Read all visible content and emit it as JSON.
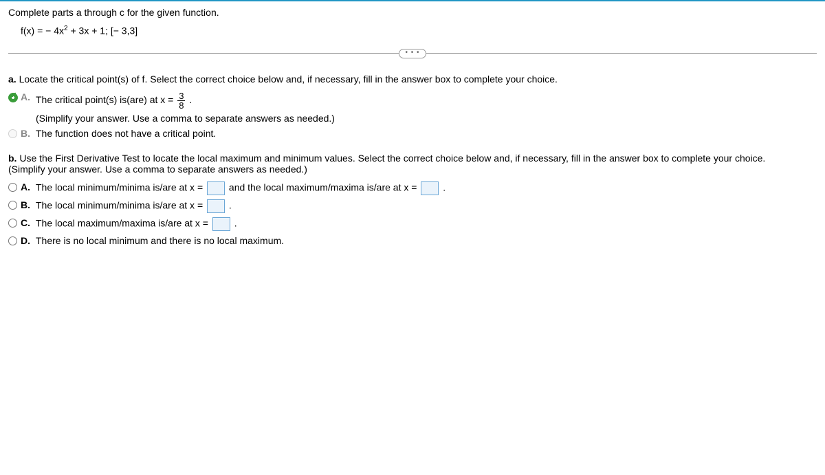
{
  "intro": "Complete parts a through c for the given function.",
  "function_prefix": "f(x) = − 4x",
  "function_exp": "2",
  "function_suffix": " + 3x + 1; [− 3,3]",
  "ellipsis": "• • •",
  "partA": {
    "prompt_prefix": "a.",
    "prompt": " Locate the critical point(s) of f. Select the correct choice below and, if necessary, fill in the answer box to complete your choice.",
    "A_letter": "A.",
    "A_text_before": "The critical point(s) is(are) at x = ",
    "A_frac_num": "3",
    "A_frac_den": "8",
    "A_text_after": " .",
    "A_hint": "(Simplify your answer. Use a comma to separate answers as needed.)",
    "B_letter": "B.",
    "B_text": "The function does not have a critical point."
  },
  "partB": {
    "prompt_prefix": "b.",
    "prompt": " Use the First Derivative Test to locate the local maximum and minimum values. Select the correct choice below and, if necessary, fill in the answer box to complete your choice.",
    "hint": "(Simplify your answer. Use a comma to separate answers as needed.)",
    "A_letter": "A.",
    "A_text1": "The local minimum/minima is/are at x = ",
    "A_text2": " and the local maximum/maxima is/are at x = ",
    "A_text3": " .",
    "B_letter": "B.",
    "B_text1": "The local minimum/minima is/are at x = ",
    "B_text2": " .",
    "C_letter": "C.",
    "C_text1": "The local maximum/maxima is/are at x = ",
    "C_text2": " .",
    "D_letter": "D.",
    "D_text": "There is no local minimum and there is no local maximum."
  }
}
